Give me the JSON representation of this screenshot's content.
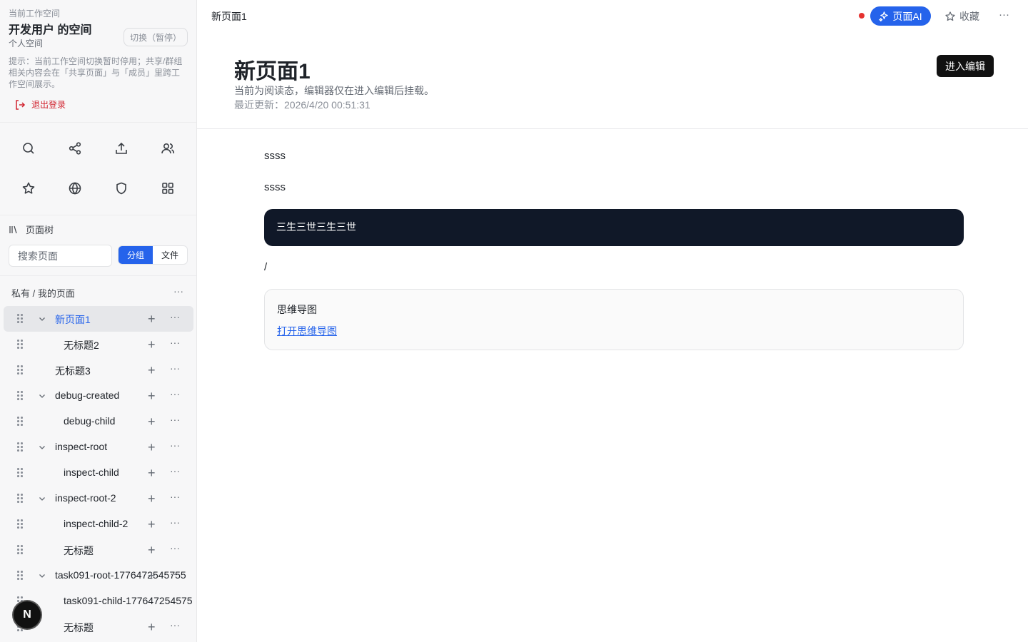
{
  "workspace": {
    "caption": "当前工作空间",
    "name": "开发用户 的空间",
    "type": "个人空间",
    "switch_label": "切换（暂停）",
    "tip": "提示：当前工作空间切换暂时停用；共享/群组相关内容会在「共享页面」与「成员」里跨工作空间展示。",
    "logout_label": "退出登录"
  },
  "quick_icons": [
    "search-icon",
    "share-icon",
    "upload-icon",
    "members-icon",
    "star-icon",
    "globe-icon",
    "shield-icon",
    "grid-icon"
  ],
  "page_tree": {
    "heading": "页面树",
    "search_placeholder": "搜索页面",
    "segments": [
      "分组",
      "文件"
    ],
    "active_segment": "分组",
    "section_title": "私有 / 我的页面",
    "items": [
      {
        "label": "新页面1",
        "expanded": true,
        "selected": true
      },
      {
        "label": "无标题2"
      },
      {
        "label": "无标题3"
      },
      {
        "label": "debug-created",
        "expanded": true
      },
      {
        "label": "debug-child"
      },
      {
        "label": "inspect-root",
        "expanded": true
      },
      {
        "label": "inspect-child"
      },
      {
        "label": "inspect-root-2",
        "expanded": true
      },
      {
        "label": "inspect-child-2"
      },
      {
        "label": "无标题"
      },
      {
        "label": "task091-root-1776472545755",
        "expanded": true
      },
      {
        "label": "task091-child-177647254575"
      },
      {
        "label": "无标题"
      }
    ]
  },
  "avatar_letter": "N",
  "topbar": {
    "breadcrumb": "新页面1",
    "ai_label": "页面AI",
    "favorite_label": "收藏",
    "more": "···"
  },
  "page": {
    "title": "新页面1",
    "read_note": "当前为阅读态，编辑器仅在进入编辑后挂载。",
    "updated": "最近更新：2026/4/20 00:51:31",
    "edit_label": "进入编辑"
  },
  "content": {
    "para1": "ssss",
    "para2": "ssss",
    "code_text": "三生三世三生三世",
    "slash": "/",
    "mindmap_title": "思维导图",
    "mindmap_link": "打开思维导图"
  },
  "colors": {
    "accent": "#2563eb",
    "danger": "#d1242f",
    "dark": "#101828"
  }
}
